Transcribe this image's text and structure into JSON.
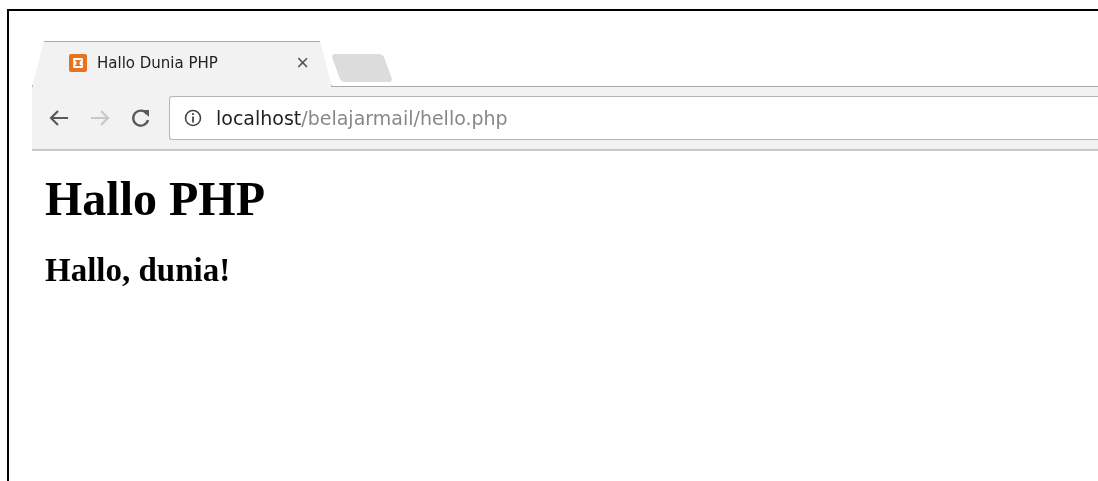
{
  "tabs": [
    {
      "title": "Hallo Dunia PHP",
      "close": "×",
      "selected": true
    }
  ],
  "toolbar": {
    "back_disabled": false,
    "forward_disabled": true,
    "url_host": "localhost",
    "url_path": "/belajarmail/hello.php"
  },
  "page": {
    "heading": "Hallo PHP",
    "subheading": "Hallo, dunia!"
  }
}
